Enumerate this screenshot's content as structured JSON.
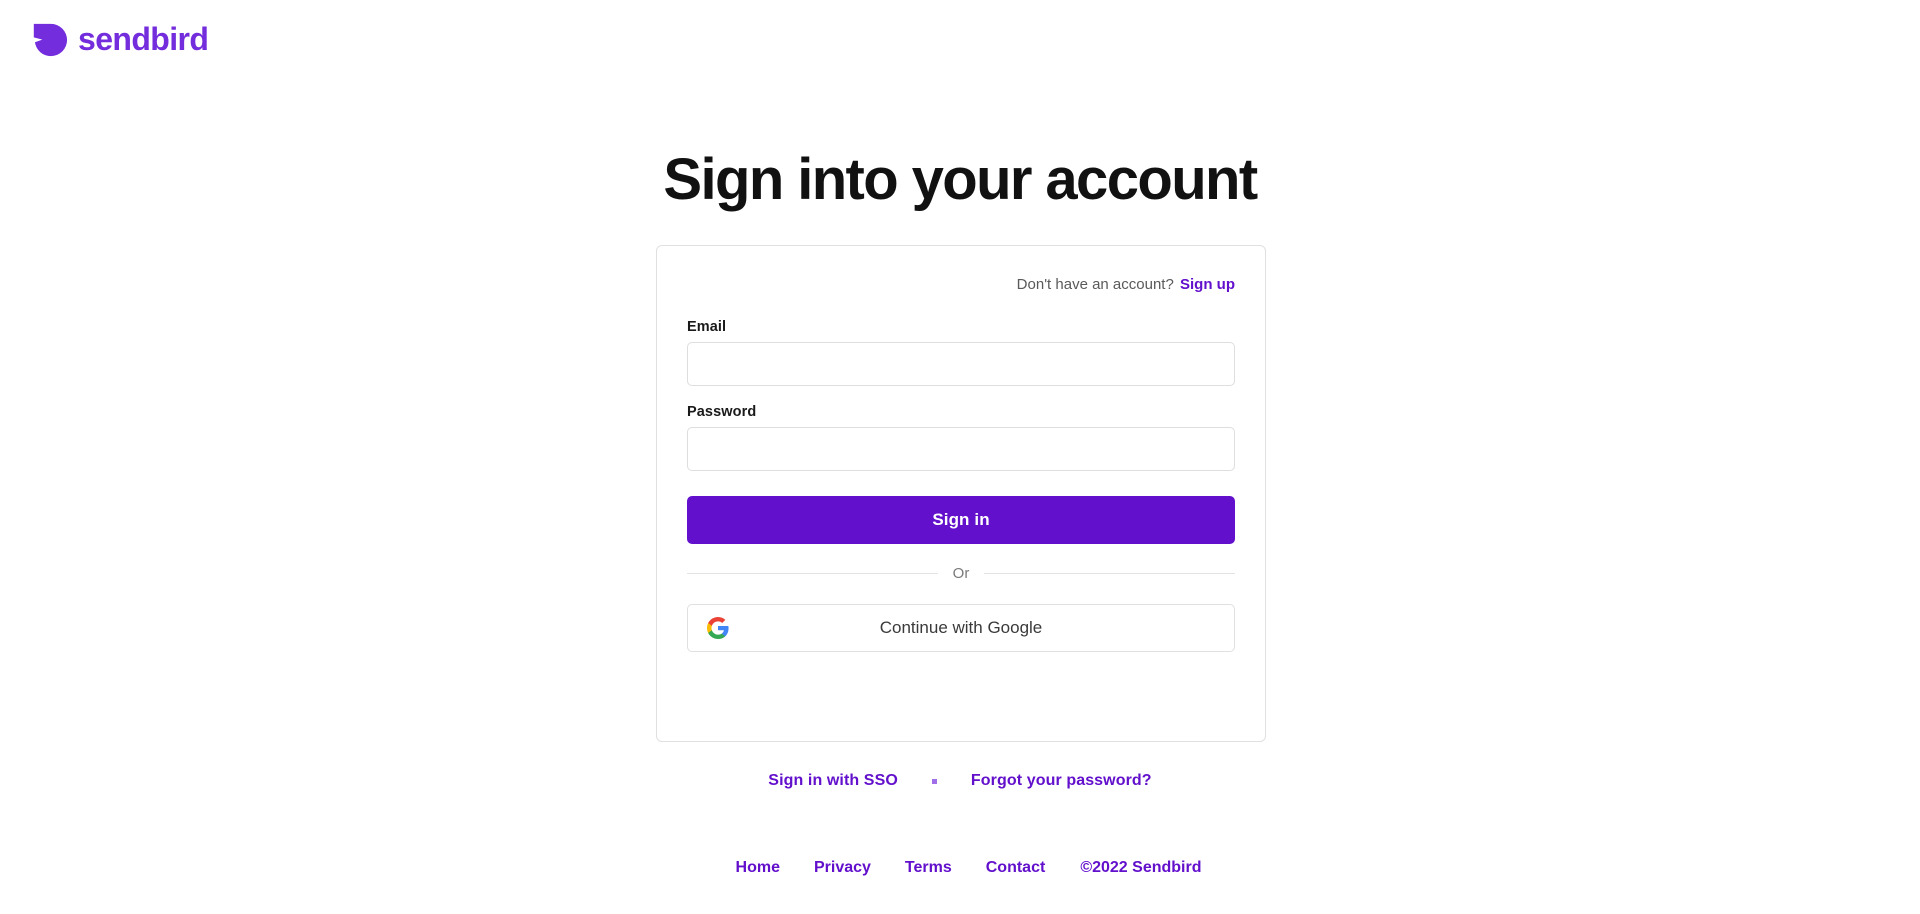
{
  "brand": {
    "name": "sendbird",
    "logo_icon": "sendbird-mark-icon",
    "primary_color": "#6210CC",
    "logo_color": "#742DDD"
  },
  "page": {
    "heading": "Sign into your account"
  },
  "card": {
    "signup_prompt": "Don't have an account?",
    "signup_link": "Sign up",
    "fields": [
      {
        "label": "Email",
        "value": "",
        "placeholder": "",
        "type": "email",
        "name": "email-field"
      },
      {
        "label": "Password",
        "value": "",
        "placeholder": "",
        "type": "password",
        "name": "password-field"
      }
    ],
    "submit_label": "Sign in",
    "divider_label": "Or",
    "google_button_label": "Continue with Google",
    "google_icon": "google-g-icon"
  },
  "alt_links": {
    "sso": "Sign in with SSO",
    "separator_icon": "square-dot-separator-icon",
    "forgot": "Forgot your password?"
  },
  "footer": {
    "links": [
      "Home",
      "Privacy",
      "Terms",
      "Contact"
    ],
    "copyright": "©2022 Sendbird"
  }
}
